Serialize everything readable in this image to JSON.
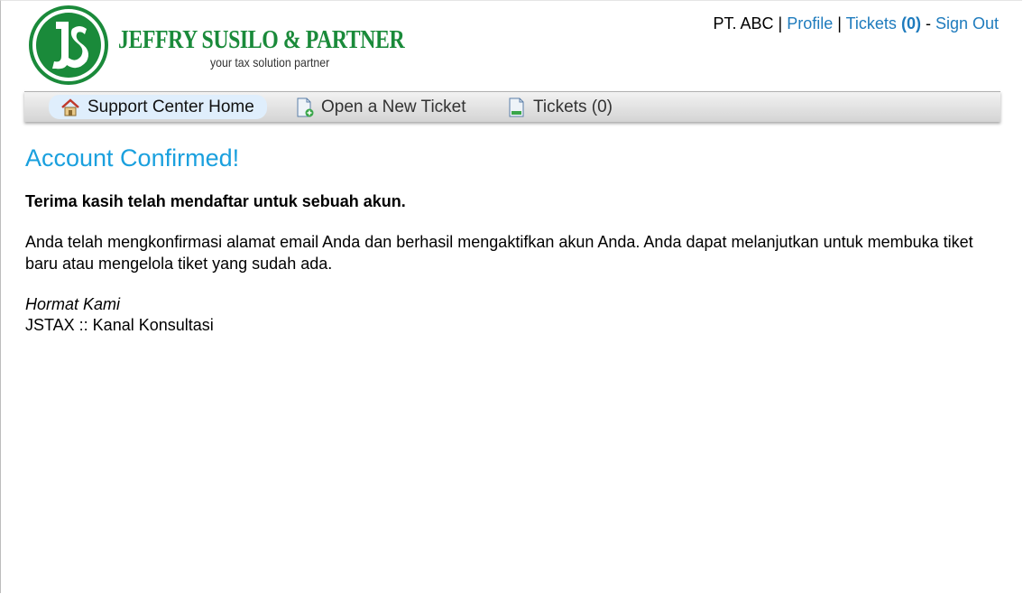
{
  "brand": {
    "title": "JEFFRY SUSILO & PARTNER",
    "tagline": "your tax solution partner",
    "primary_color": "#1a8a3a"
  },
  "userbar": {
    "user_name": "PT. ABC",
    "sep1": " | ",
    "profile_label": "Profile",
    "sep2": " | ",
    "tickets_label": "Tickets",
    "tickets_count": "(0)",
    "sep3": " - ",
    "signout_label": "Sign Out",
    "link_color": "#1e7bbd"
  },
  "nav": {
    "items": [
      {
        "label": "Support Center Home",
        "icon": "home-icon",
        "active": true
      },
      {
        "label": "Open a New Ticket",
        "icon": "new-ticket-icon",
        "active": false
      },
      {
        "label": "Tickets (0)",
        "icon": "tickets-icon",
        "active": false
      }
    ]
  },
  "main": {
    "title": "Account Confirmed!",
    "lead": "Terima kasih telah mendaftar untuk sebuah akun.",
    "body": "Anda telah mengkonfirmasi alamat email Anda dan berhasil mengaktifkan akun Anda. Anda dapat melanjutkan untuk membuka tiket baru atau mengelola tiket yang sudah ada.",
    "signature_line1": "Hormat Kami",
    "signature_line2": "JSTAX :: Kanal Konsultasi",
    "title_color": "#1aa0de"
  }
}
